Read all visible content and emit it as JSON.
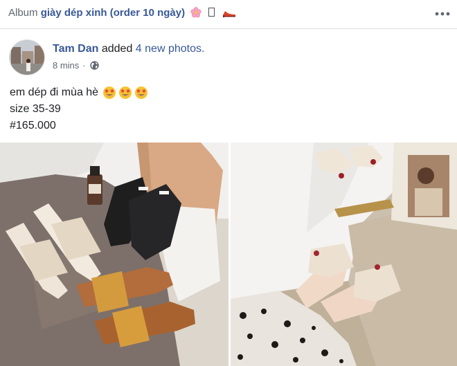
{
  "album": {
    "prefix": "Album",
    "name": "giày dép xinh (order 10 ngày)"
  },
  "post": {
    "author": "Tam Dan",
    "action": "added",
    "photos_link": "4 new photos.",
    "time": "8 mins",
    "meta_separator": "·",
    "caption": {
      "line1": "em dép đi mùa hè",
      "line2": "size 35-39",
      "line3": "#165.000"
    }
  },
  "colors": {
    "link": "#385898",
    "secondary_text": "#606770",
    "divider": "#dddfe2"
  },
  "icons": {
    "album_flower": "cherry-blossom-icon",
    "album_box": "missing-glyph-icon",
    "album_shoe": "high-heel-icon",
    "menu": "more-horizontal-icon",
    "privacy": "globe-icon",
    "caption_emoji": "star-struck-emoji-icon"
  }
}
